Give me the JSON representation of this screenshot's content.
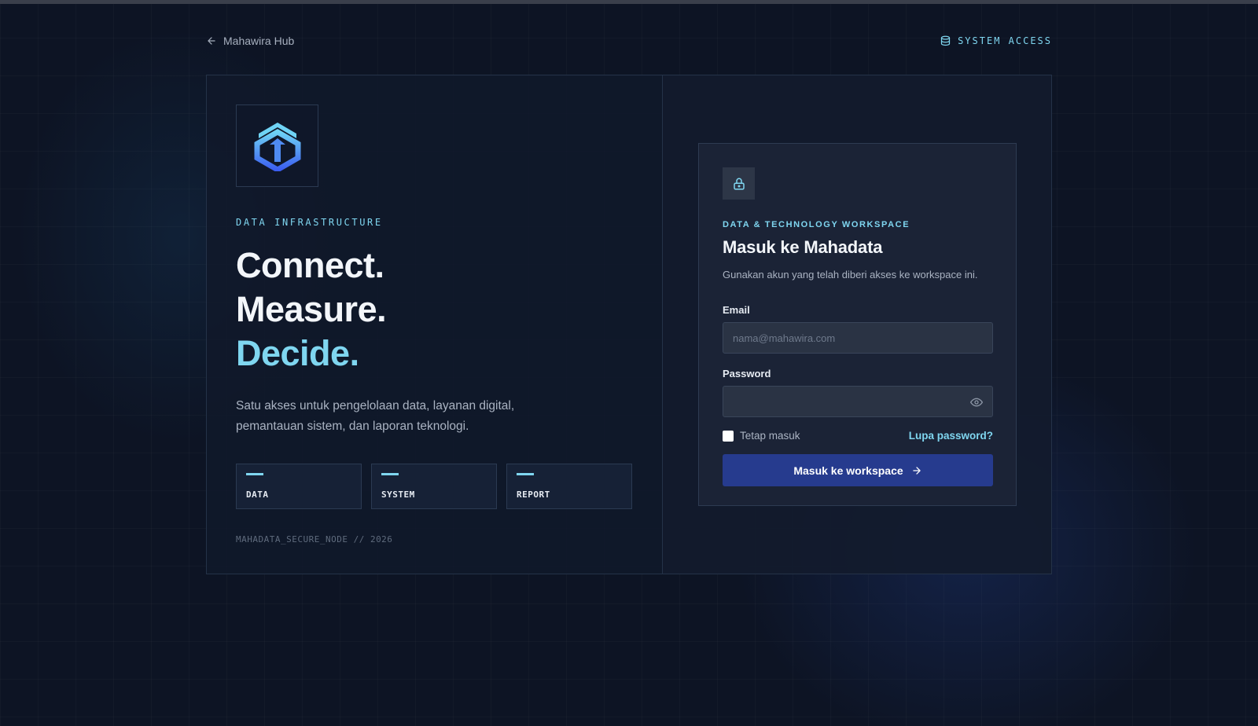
{
  "nav": {
    "back_label": "Mahawira Hub",
    "system_access": "SYSTEM ACCESS"
  },
  "hero": {
    "eyebrow": "DATA INFRASTRUCTURE",
    "headline": [
      "Connect.",
      "Measure.",
      "Decide."
    ],
    "description": "Satu akses untuk pengelolaan data, layanan digital, pemantauan sistem, dan laporan teknologi.",
    "tiles": [
      "DATA",
      "SYSTEM",
      "REPORT"
    ],
    "footer_code": "MAHADATA_SECURE_NODE // 2026"
  },
  "login": {
    "eyebrow": "DATA & TECHNOLOGY WORKSPACE",
    "title": "Masuk ke Mahadata",
    "subtitle": "Gunakan akun yang telah diberi akses ke workspace ini.",
    "email_label": "Email",
    "email_placeholder": "nama@mahawira.com",
    "email_value": "",
    "password_label": "Password",
    "password_value": "",
    "remember_label": "Tetap masuk",
    "remember_checked": false,
    "forgot_label": "Lupa password?",
    "submit_label": "Masuk ke workspace"
  },
  "colors": {
    "accent": "#7fd6f0",
    "button": "#263b8e",
    "background": "#0d1424"
  },
  "icons": {
    "back": "arrow-left-icon",
    "system": "database-icon",
    "lock": "lock-icon",
    "eye": "eye-icon",
    "submit": "arrow-right-icon"
  }
}
